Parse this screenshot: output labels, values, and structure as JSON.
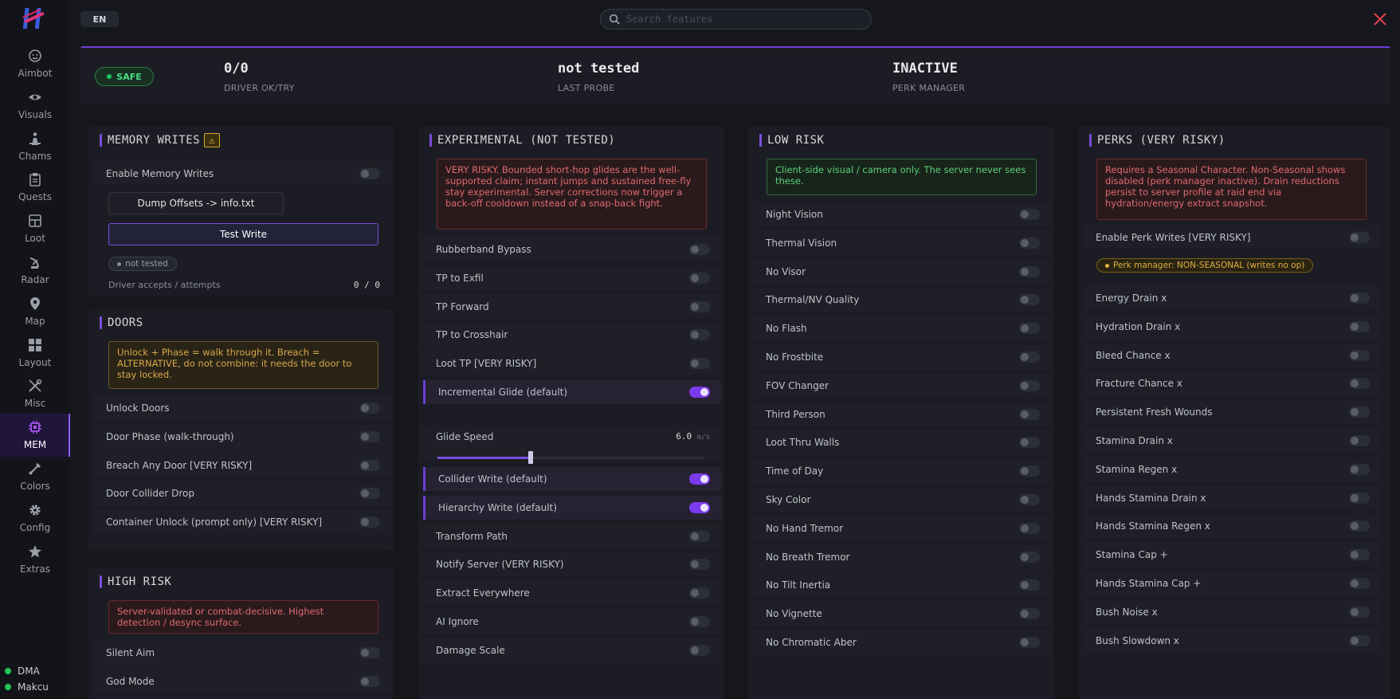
{
  "sidebar": {
    "items": [
      {
        "label": "Aimbot",
        "icon": "smile-icon"
      },
      {
        "label": "Visuals",
        "icon": "eye-icon"
      },
      {
        "label": "Chams",
        "icon": "figure-icon"
      },
      {
        "label": "Quests",
        "icon": "clipboard-icon"
      },
      {
        "label": "Loot",
        "icon": "box-icon"
      },
      {
        "label": "Radar",
        "icon": "satellite-dish-icon"
      },
      {
        "label": "Map",
        "icon": "map-pin-icon"
      },
      {
        "label": "Layout",
        "icon": "grid-icon"
      },
      {
        "label": "Misc",
        "icon": "tools-icon"
      },
      {
        "label": "MEM",
        "icon": "chip-icon",
        "active": true
      },
      {
        "label": "Colors",
        "icon": "brush-icon"
      },
      {
        "label": "Config",
        "icon": "gear-icon"
      },
      {
        "label": "Extras",
        "icon": "star-icon"
      }
    ],
    "status": [
      {
        "label": "DMA",
        "color": "#22c55e"
      },
      {
        "label": "Makcu",
        "color": "#22c55e"
      }
    ]
  },
  "topbar": {
    "lang": "EN",
    "search_placeholder": "Search features"
  },
  "status_panel": {
    "badge": "SAFE",
    "stats": [
      {
        "value": "0/0",
        "label": "DRIVER OK/TRY"
      },
      {
        "value": "not tested",
        "label": "LAST PROBE"
      },
      {
        "value": "INACTIVE",
        "label": "PERK MANAGER"
      }
    ]
  },
  "memory_writes": {
    "title": "MEMORY WRITES",
    "enable_label": "Enable Memory Writes",
    "dump_button": "Dump Offsets -> info.txt",
    "test_button": "Test Write",
    "test_status": "not tested",
    "driver_label": "Driver accepts / attempts",
    "driver_value": "0 / 0"
  },
  "doors": {
    "title": "DOORS",
    "note": "Unlock + Phase = walk through it. Breach = ALTERNATIVE, do not combine: it needs the door to stay locked.",
    "rows": [
      "Unlock Doors",
      "Door Phase (walk-through)",
      "Breach Any Door [VERY RISKY]",
      "Door Collider Drop",
      "Container Unlock (prompt only) [VERY RISKY]"
    ]
  },
  "high_risk": {
    "title": "HIGH RISK",
    "note": "Server-validated or combat-decisive. Highest detection / desync surface.",
    "rows": [
      "Silent Aim",
      "God Mode"
    ]
  },
  "experimental": {
    "title": "EXPERIMENTAL (NOT TESTED)",
    "note": "VERY RISKY. Bounded short-hop glides are the well-supported claim; instant jumps and sustained free-fly stay experimental. Server corrections now trigger a back-off cooldown instead of a snap-back fight.",
    "rows_a": [
      {
        "label": "Rubberband Bypass",
        "on": false
      },
      {
        "label": "TP to Exfil",
        "on": false
      },
      {
        "label": "TP Forward",
        "on": false
      },
      {
        "label": "TP to Crosshair",
        "on": false
      },
      {
        "label": "Loot TP [VERY RISKY]",
        "on": false
      },
      {
        "label": "Incremental Glide (default)",
        "on": true
      }
    ],
    "slider_label": "Glide Speed",
    "slider_value": "6.0",
    "slider_unit": "m/s",
    "slider_fraction": 0.35,
    "rows_b": [
      {
        "label": "Collider Write (default)",
        "on": true
      },
      {
        "label": "Hierarchy Write (default)",
        "on": true
      },
      {
        "label": "Transform Path",
        "on": false
      },
      {
        "label": "Notify Server (VERY RISKY)",
        "on": false
      },
      {
        "label": "Extract Everywhere",
        "on": false
      },
      {
        "label": "AI Ignore",
        "on": false
      },
      {
        "label": "Damage Scale",
        "on": false
      }
    ]
  },
  "low_risk": {
    "title": "LOW RISK",
    "note": "Client-side visual / camera only. The server never sees these.",
    "rows": [
      "Night Vision",
      "Thermal Vision",
      "No Visor",
      "Thermal/NV Quality",
      "No Flash",
      "No Frostbite",
      "FOV Changer",
      "Third Person",
      "Loot Thru Walls",
      "Time of Day",
      "Sky Color",
      "No Hand Tremor",
      "No Breath Tremor",
      "No Tilt Inertia",
      "No Vignette",
      "No Chromatic Aber"
    ]
  },
  "perks": {
    "title": "PERKS (VERY RISKY)",
    "note": "Requires a Seasonal Character. Non-Seasonal shows disabled (perk manager inactive). Drain reductions persist to server profile at raid end via hydration/energy extract snapshot.",
    "enable_label": "Enable Perk Writes [VERY RISKY]",
    "manager_pill": "Perk manager: NON-SEASONAL (writes no op)",
    "rows": [
      "Energy Drain x",
      "Hydration Drain x",
      "Bleed Chance x",
      "Fracture Chance x",
      "Persistent Fresh Wounds",
      "Stamina Drain x",
      "Stamina Regen x",
      "Hands Stamina Drain x",
      "Hands Stamina Regen x",
      "Stamina Cap +",
      "Hands Stamina Cap +",
      "Bush Noise x",
      "Bush Slowdown x"
    ]
  }
}
